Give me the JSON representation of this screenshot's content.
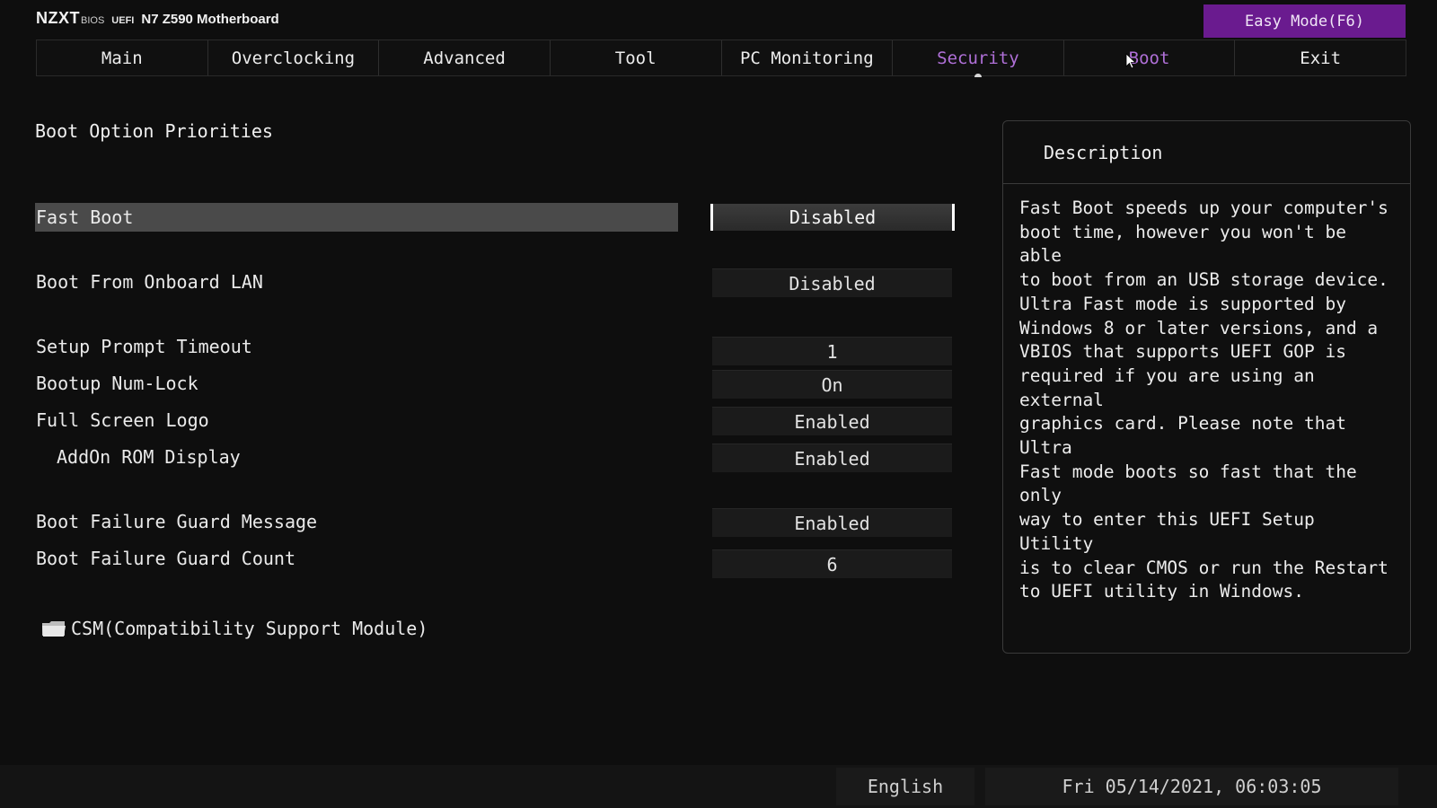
{
  "brand": {
    "logo": "NZXT",
    "bios": "BIOS",
    "uefi": "UEFI",
    "model": "N7 Z590 Motherboard"
  },
  "easy_mode_label": "Easy Mode(F6)",
  "tabs": [
    {
      "label": "Main"
    },
    {
      "label": "Overclocking"
    },
    {
      "label": "Advanced"
    },
    {
      "label": "Tool"
    },
    {
      "label": "PC Monitoring"
    },
    {
      "label": "Security"
    },
    {
      "label": "Boot"
    },
    {
      "label": "Exit"
    }
  ],
  "active_tab": "Security",
  "section_title": "Boot Option Priorities",
  "settings": [
    {
      "label": "Fast Boot",
      "value": "Disabled"
    },
    {
      "label": "Boot From Onboard LAN",
      "value": "Disabled"
    },
    {
      "label": "Setup Prompt Timeout",
      "value": "1"
    },
    {
      "label": "Bootup Num-Lock",
      "value": "On"
    },
    {
      "label": "Full Screen Logo",
      "value": "Enabled"
    },
    {
      "label": "AddOn ROM Display",
      "value": "Enabled"
    },
    {
      "label": "Boot Failure Guard Message",
      "value": "Enabled"
    },
    {
      "label": "Boot Failure Guard Count",
      "value": "6"
    }
  ],
  "csm_label": "CSM(Compatibility Support Module)",
  "description": {
    "title": "Description",
    "text": "Fast Boot speeds up your computer's\nboot time, however you won't be able\nto boot from an USB storage device.\nUltra Fast mode is supported by\nWindows 8 or later versions, and a\nVBIOS that supports UEFI GOP is\nrequired if you are using an external\ngraphics card. Please note that Ultra\nFast mode boots so fast that the only\nway to enter this UEFI Setup Utility\nis to clear CMOS or run the Restart\nto UEFI utility in Windows."
  },
  "footer": {
    "language": "English",
    "datetime": "Fri 05/14/2021, 06:03:05"
  },
  "colors": {
    "accent": "#b070d8",
    "easy_mode_bg": "#6a1b8f",
    "background": "#0e0e0e"
  }
}
